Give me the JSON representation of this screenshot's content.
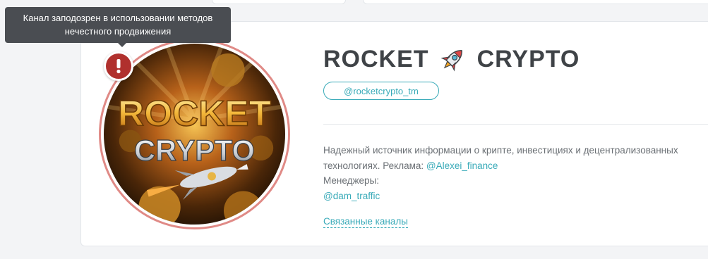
{
  "tooltip": {
    "line1": "Канал заподозрен в использовании методов",
    "line2": "нечестного продвижения"
  },
  "warning_badge": {
    "symbol": "!",
    "color": "#b0302d"
  },
  "channel": {
    "title_left": "ROCKET",
    "title_right": "CRYPTO",
    "title_icon": "rocket-icon",
    "handle": "@rocketcrypto_tm",
    "avatar": {
      "line1": "ROCKET",
      "line2": "CRYPTO"
    }
  },
  "description": {
    "line1": "Надежный источник информации о крипте, инвестициях и децентрализованных",
    "line2_text": "технологиях. Реклама: ",
    "line2_link": "@Alexei_finance",
    "managers_label": "Менеджеры:",
    "manager_link": "@dam_traffic"
  },
  "related_link": "Связанные каналы",
  "colors": {
    "accent": "#38aab8",
    "title": "#3f4347",
    "ring": "#e08a86",
    "tooltip_bg": "#4a4d52"
  }
}
